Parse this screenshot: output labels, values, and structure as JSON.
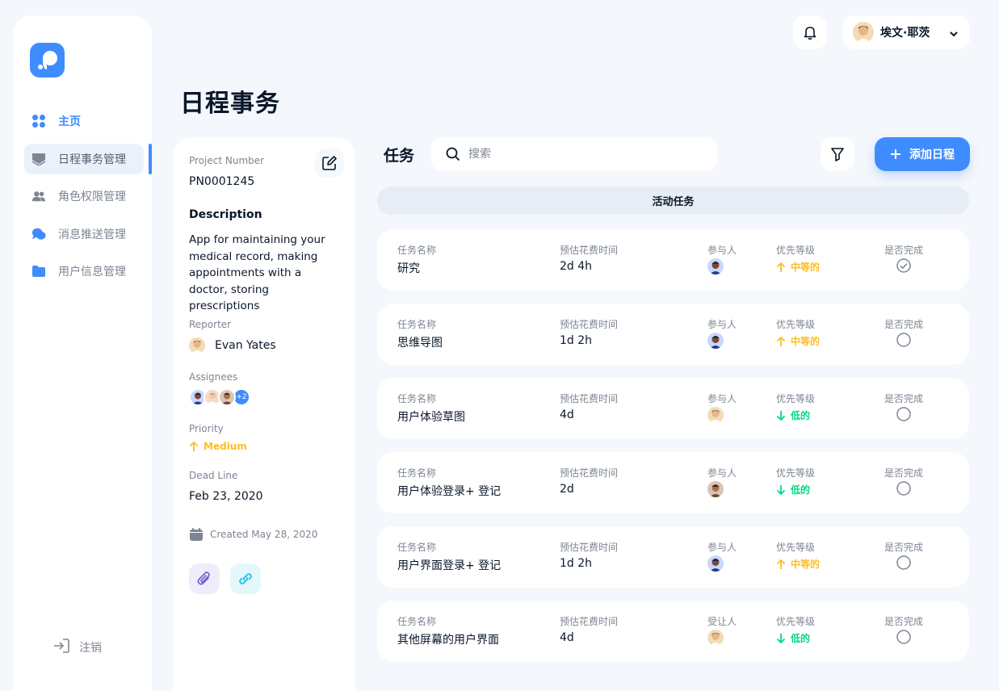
{
  "sidebar": {
    "items": [
      {
        "label": "主页"
      },
      {
        "label": "日程事务管理"
      },
      {
        "label": "角色权限管理"
      },
      {
        "label": "消息推送管理"
      },
      {
        "label": "用户信息管理"
      }
    ],
    "logout_label": "注销"
  },
  "header": {
    "user_name": "埃文·耶茨"
  },
  "page_title": "日程事务",
  "project": {
    "number_label": "Project Number",
    "number": "PN0001245",
    "description_title": "Description",
    "description": "App for maintaining your medical record, making appointments with a doctor, storing prescriptions",
    "reporter_label": "Reporter",
    "reporter": "Evan Yates",
    "assignees_label": "Assignees",
    "assignees_more": "+2",
    "priority_label": "Priority",
    "priority": "Medium",
    "deadline_label": "Dead Line",
    "deadline": "Feb 23, 2020",
    "created": "Created May 28, 2020"
  },
  "tasks": {
    "title": "任务",
    "search_placeholder": "搜索",
    "add_label": "添加日程",
    "active_label": "活动任务",
    "headers": {
      "name": "任务名称",
      "time": "预估花费时间",
      "participant": "参与人",
      "priority": "优先等级",
      "done": "是否完成"
    },
    "rows": [
      {
        "name": "研究",
        "time": "2d 4h",
        "participant_label": "参与人",
        "priority": "中等的",
        "priority_level": "medium",
        "done": true
      },
      {
        "name": "思维导图",
        "time": "1d 2h",
        "participant_label": "参与人",
        "priority": "中等的",
        "priority_level": "medium",
        "done": false
      },
      {
        "name": "用户体验草图",
        "time": "4d",
        "participant_label": "参与人",
        "priority": "低的",
        "priority_level": "low",
        "done": false
      },
      {
        "name": "用户体验登录+ 登记",
        "time": "2d",
        "participant_label": "参与人",
        "priority": "低的",
        "priority_level": "low",
        "done": false
      },
      {
        "name": "用户界面登录+ 登记",
        "time": "1d 2h",
        "participant_label": "参与人",
        "priority": "中等的",
        "priority_level": "medium",
        "done": false
      },
      {
        "name": "其他屏幕的用户界面",
        "time": "4d",
        "participant_label": "受让人",
        "priority": "低的",
        "priority_level": "low",
        "done": false
      }
    ]
  },
  "colors": {
    "accent": "#3f8cff",
    "medium": "#ffbd21",
    "low": "#00d97e",
    "background": "#f4f7fb"
  }
}
